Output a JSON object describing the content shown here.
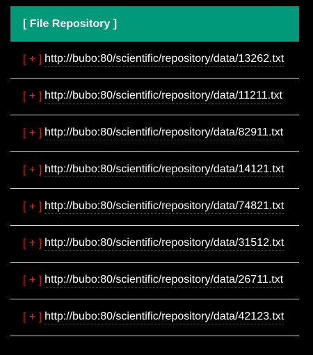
{
  "header": {
    "title": "[ File Repository ]"
  },
  "files": [
    {
      "toggle": "[ + ]",
      "url": "http://bubo:80/scientific/repository/data/13262.txt"
    },
    {
      "toggle": "[ + ]",
      "url": "http://bubo:80/scientific/repository/data/11211.txt"
    },
    {
      "toggle": "[ + ]",
      "url": "http://bubo:80/scientific/repository/data/82911.txt"
    },
    {
      "toggle": "[ + ]",
      "url": "http://bubo:80/scientific/repository/data/14121.txt"
    },
    {
      "toggle": "[ + ]",
      "url": "http://bubo:80/scientific/repository/data/74821.txt"
    },
    {
      "toggle": "[ + ]",
      "url": "http://bubo:80/scientific/repository/data/31512.txt"
    },
    {
      "toggle": "[ + ]",
      "url": "http://bubo:80/scientific/repository/data/26711.txt"
    },
    {
      "toggle": "[ + ]",
      "url": "http://bubo:80/scientific/repository/data/42123.txt"
    }
  ],
  "colors": {
    "header_bg": "#009a7a",
    "toggle": "#e01818",
    "background": "#000000",
    "text": "#ffffff"
  }
}
